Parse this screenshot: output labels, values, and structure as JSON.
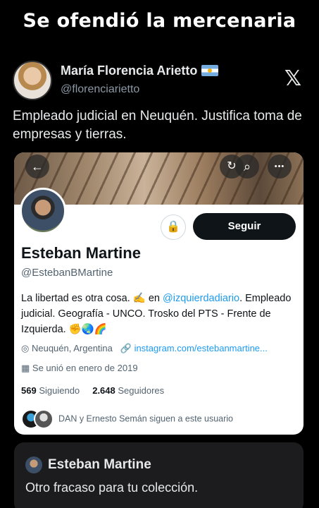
{
  "headline": "Se ofendió la mercenaria",
  "tweet": {
    "author_name": "María Florencia Arietto",
    "author_handle": "@florenciarietto",
    "platform_logo": "𝕏",
    "text": "Empleado judicial en Neuquén. Justifica toma de empresas y tierras."
  },
  "profile_card": {
    "buttons": {
      "back": "←",
      "search": "⌕",
      "more": "•••",
      "follow": "Seguir",
      "lock_icon": "🔒"
    },
    "name": "Esteban Martine",
    "handle": "@EstebanBMartine",
    "bio_part1": "La libertad es otra cosa. ✍️ en ",
    "bio_link": "@izquierdadiario",
    "bio_part2": ". Empleado judicial. Geografía - UNCO. Trosko del PTS - Frente de Izquierda. ✊🌏🌈",
    "location": "Neuquén, Argentina",
    "website": "instagram.com/estebanmartine...",
    "joined": "Se unió en enero de 2019",
    "following_count": "569",
    "following_label": "Siguiendo",
    "followers_count": "2.648",
    "followers_label": "Seguidores",
    "followed_by": "DAN y Ernesto Semán siguen a este usuario"
  },
  "reply": {
    "name": "Esteban Martine",
    "text": "Otro fracaso para tu colección."
  },
  "icons": [
    "back-arrow-icon",
    "search-icon",
    "more-icon",
    "lock-icon",
    "location-icon",
    "link-icon",
    "calendar-icon",
    "x-logo-icon",
    "argentina-flag-icon"
  ]
}
